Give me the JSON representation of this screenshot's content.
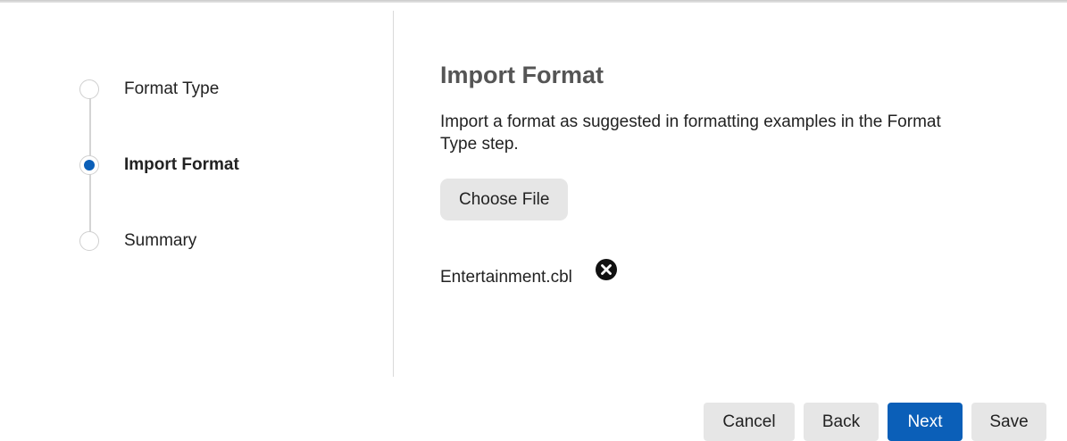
{
  "stepper": {
    "steps": [
      {
        "label": "Format Type",
        "state": "inactive"
      },
      {
        "label": "Import Format",
        "state": "active"
      },
      {
        "label": "Summary",
        "state": "inactive"
      }
    ]
  },
  "main": {
    "title": "Import Format",
    "description": "Import a format as suggested in formatting examples in the Format Type step.",
    "choose_file_label": "Choose File",
    "file": {
      "name": "Entertainment.cbl",
      "remove_icon": "close-circle-icon"
    }
  },
  "footer": {
    "cancel_label": "Cancel",
    "back_label": "Back",
    "next_label": "Next",
    "save_label": "Save"
  },
  "colors": {
    "accent": "#0b5fb8",
    "title": "#555555",
    "button_secondary": "#e6e6e6"
  }
}
